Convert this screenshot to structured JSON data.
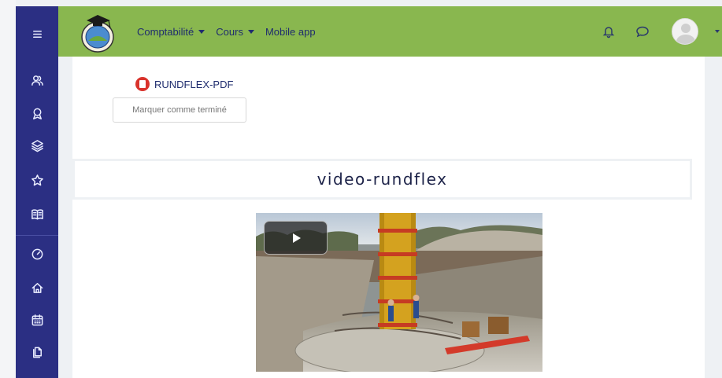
{
  "topbar": {
    "nav": [
      {
        "label": "Comptabilité",
        "has_caret": true
      },
      {
        "label": "Cours",
        "has_caret": true
      },
      {
        "label": "Mobile app",
        "has_caret": false
      }
    ],
    "icons": [
      "bell-icon",
      "chat-icon"
    ],
    "color": "#89b74f"
  },
  "sidebar": {
    "color": "#2b2f83",
    "items": [
      "menu-icon",
      "users-icon",
      "badge-icon",
      "layers-icon",
      "star-icon",
      "book-icon",
      "dashboard-icon",
      "home-icon",
      "calendar-icon",
      "files-icon"
    ]
  },
  "resource": {
    "pdf_label": "RUNDFLEX-PDF",
    "mark_button": "Marquer comme terminé"
  },
  "section": {
    "title": "video-rundflex"
  },
  "video": {
    "play_icon": "play-icon"
  }
}
